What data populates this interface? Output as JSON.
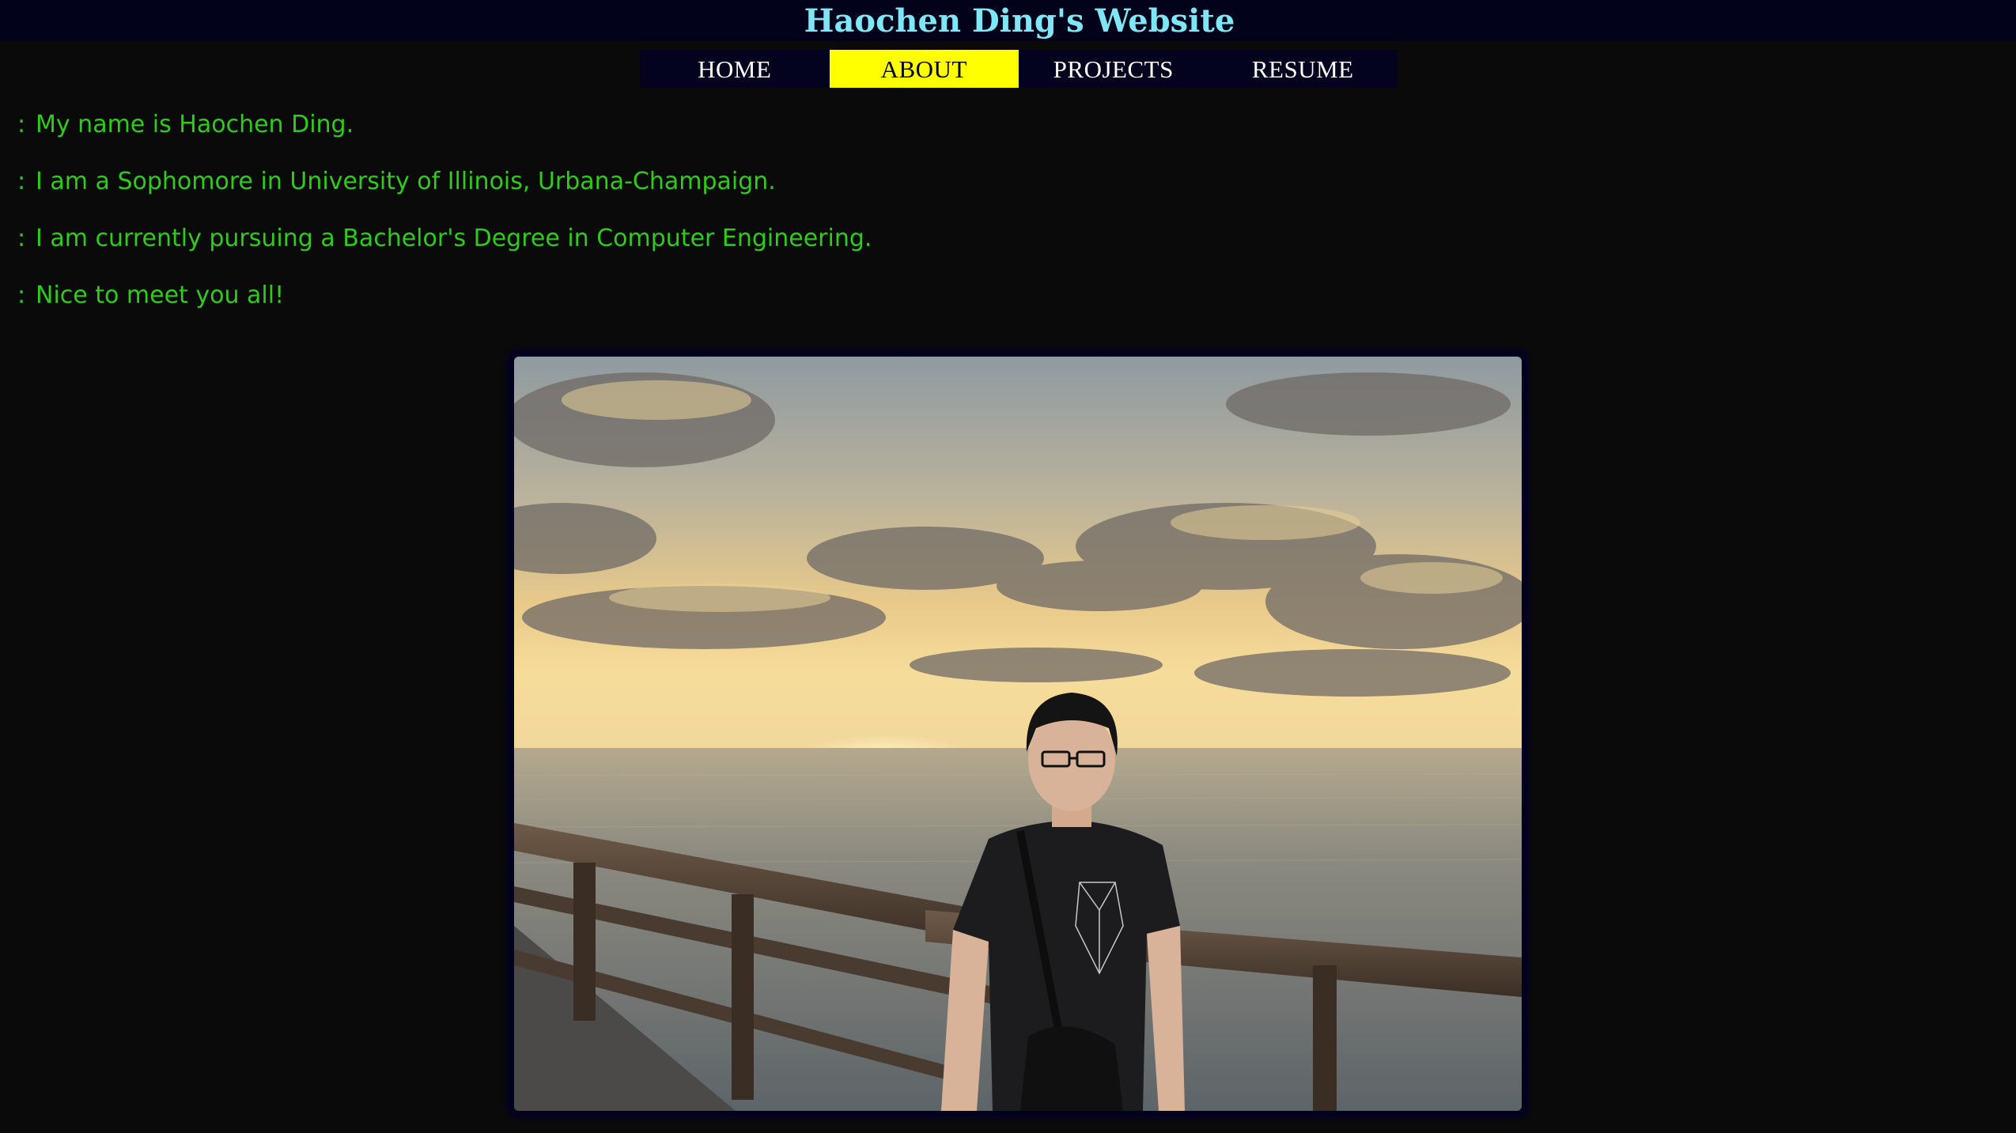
{
  "header": {
    "title": "Haochen Ding's Website"
  },
  "nav": {
    "items": [
      {
        "label": "HOME",
        "active": false
      },
      {
        "label": "ABOUT",
        "active": true
      },
      {
        "label": "PROJECTS",
        "active": false
      },
      {
        "label": "RESUME",
        "active": false
      }
    ]
  },
  "about": {
    "bullet": ":",
    "lines": [
      "My name is Haochen Ding.",
      "I am a Sophomore in University of Illinois, Urbana-Champaign.",
      "I am currently pursuing a Bachelor's Degree in Computer Engineering.",
      "Nice to meet you all!"
    ]
  },
  "photo": {
    "icon": "portrait-photo"
  },
  "colors": {
    "title": "#7fe6f6",
    "nav_active": "#ffff00",
    "text": "#2ecb1a",
    "background": "#0a0a0a"
  }
}
